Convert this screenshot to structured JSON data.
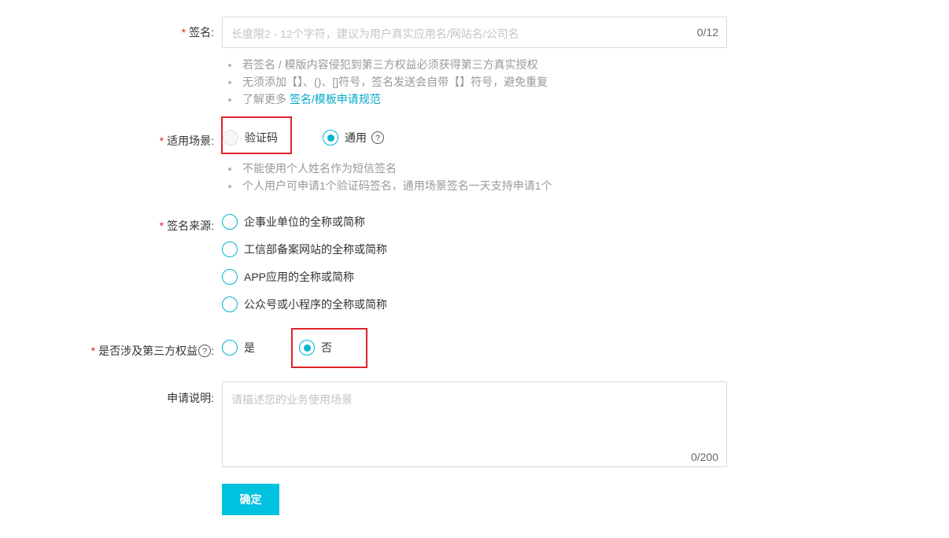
{
  "signature": {
    "required": "*",
    "label": "签名:",
    "placeholder": "长度限2 - 12个字符，建议为用户真实应用名/网站名/公司名",
    "counter": "0/12",
    "hints": [
      "若签名 / 模版内容侵犯到第三方权益必须获得第三方真实授权",
      "无须添加【】、()、[]符号，签名发送会自带【】符号，避免重复"
    ],
    "more_prefix": "了解更多 ",
    "more_link": "签名/模板申请规范"
  },
  "scenario": {
    "required": "*",
    "label": "适用场景:",
    "options": [
      {
        "label": "验证码",
        "state": "disabled"
      },
      {
        "label": "通用",
        "state": "checked"
      }
    ],
    "help_icon": "?",
    "hints": [
      "不能使用个人姓名作为短信签名",
      "个人用户可申请1个验证码签名，通用场景签名一天支持申请1个"
    ]
  },
  "source": {
    "required": "*",
    "label": "签名来源:",
    "options": [
      "企事业单位的全称或简称",
      "工信部备案网站的全称或简称",
      "APP应用的全称或简称",
      "公众号或小程序的全称或简称"
    ]
  },
  "third_party": {
    "required": "*",
    "label": "是否涉及第三方权益",
    "help_icon": "?",
    "colon": ":",
    "options": [
      {
        "label": "是",
        "state": "unchecked"
      },
      {
        "label": "否",
        "state": "checked"
      }
    ]
  },
  "description": {
    "label": "申请说明:",
    "placeholder": "请描述您的业务使用场景",
    "counter": "0/200"
  },
  "submit": {
    "label": "确定"
  },
  "colors": {
    "accent": "#00c1de",
    "required": "#e02020",
    "highlight_box": "#e0242a"
  }
}
